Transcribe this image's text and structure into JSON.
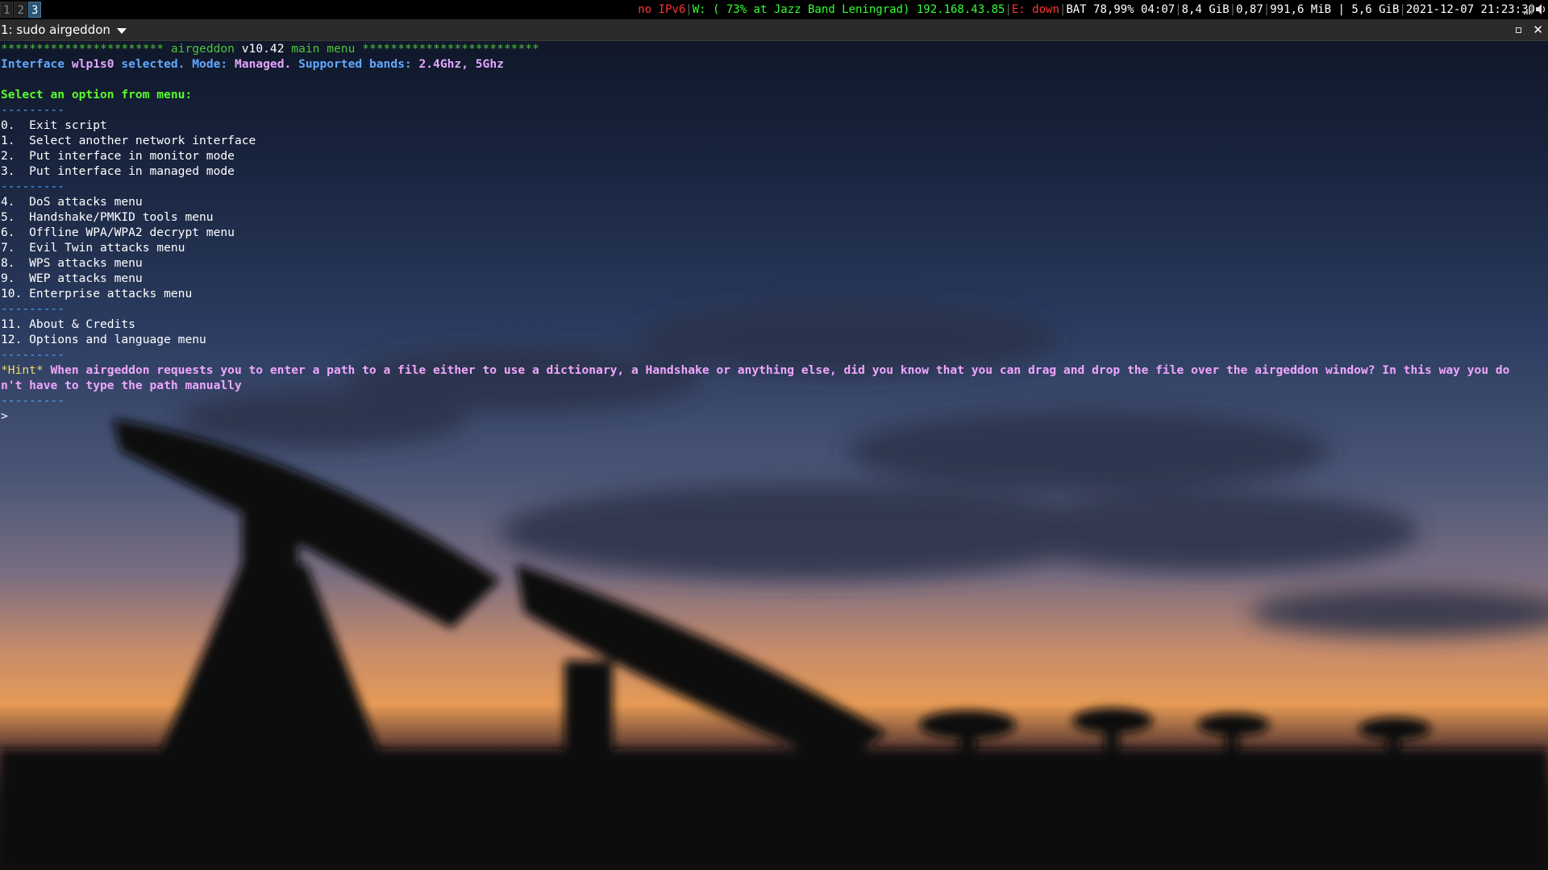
{
  "workspaces": [
    {
      "label": "1",
      "active": false
    },
    {
      "label": "2",
      "active": false
    },
    {
      "label": "3",
      "active": true
    }
  ],
  "status": {
    "ipv6": "no IPv6",
    "wifi": "W: ( 73% at Jazz Band Leningrad) 192.168.43.85",
    "ethernet": "E: down",
    "battery": "BAT 78,99% 04:07",
    "disk": "8,4 GiB",
    "load": "0,87",
    "memory": "991,6 MiB",
    "memory_total": "5,6 GiB",
    "datetime": "2021-12-07 21:23:30"
  },
  "window": {
    "title": "1: sudo airgeddon"
  },
  "terminal": {
    "header_stars_left": "***********************",
    "header_app": "airgeddon",
    "header_version": "v10.42",
    "header_menu": "main menu",
    "header_stars_right": "*************************",
    "iface_prefix": "Interface",
    "iface_name": "wlp1s0",
    "iface_selected": "selected.",
    "mode_label": "Mode:",
    "mode_value": "Managed.",
    "bands_label": "Supported bands:",
    "bands_value": "2.4Ghz, 5Ghz",
    "select_prompt": "Select an option from menu:",
    "separator": "---------",
    "menu_group_1": [
      "0.  Exit script",
      "1.  Select another network interface",
      "2.  Put interface in monitor mode",
      "3.  Put interface in managed mode"
    ],
    "menu_group_2": [
      "4.  DoS attacks menu",
      "5.  Handshake/PMKID tools menu",
      "6.  Offline WPA/WPA2 decrypt menu",
      "7.  Evil Twin attacks menu",
      "8.  WPS attacks menu",
      "9.  WEP attacks menu",
      "10. Enterprise attacks menu"
    ],
    "menu_group_3": [
      "11. About & Credits",
      "12. Options and language menu"
    ],
    "hint_tag": "*Hint*",
    "hint_line_1": " When airgeddon requests you to enter a path to a file either to use a dictionary, a Handshake or anything else, did you know that you can drag and drop the file over the airgeddon window? In this way you do",
    "hint_line_2": "n't have to type the path manually",
    "prompt": ">"
  },
  "icons": {
    "tray": [
      "signal-icon",
      "volume-icon"
    ],
    "window": [
      "maximize-icon",
      "close-icon",
      "dropdown-icon"
    ]
  },
  "colors": {
    "workspace_active": "#285577",
    "status_error": "#ff3333",
    "status_ok": "#33ff33",
    "term_green": "#4fc33d",
    "term_blue": "#62a9ff",
    "term_pink": "#e3a6ff",
    "term_bright_green": "#59ff2b",
    "term_yellow": "#f0d86a"
  }
}
